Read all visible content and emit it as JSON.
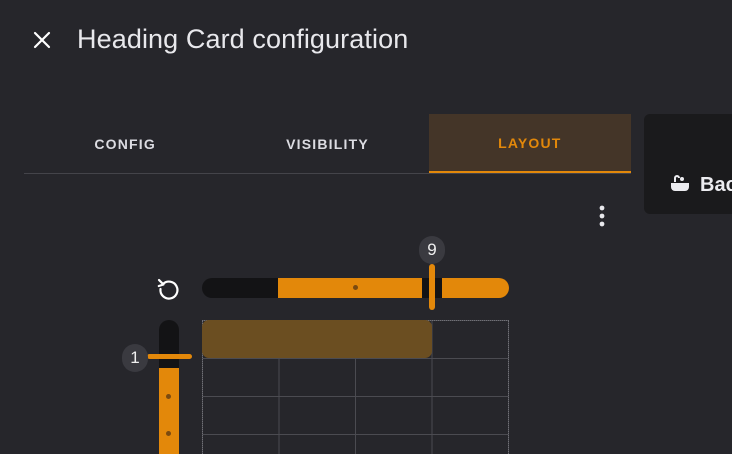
{
  "dialog": {
    "title": "Heading Card configuration",
    "close_icon": "close-icon"
  },
  "tabs": [
    {
      "label": "CONFIG",
      "active": false
    },
    {
      "label": "VISIBILITY",
      "active": false
    },
    {
      "label": "LAYOUT",
      "active": true
    }
  ],
  "preview": {
    "icon": "bathtub-icon",
    "text": "Bac"
  },
  "layout_editor": {
    "menu_icon": "dots-vertical-icon",
    "reset_icon": "restore-icon",
    "columns_value": "9",
    "rows_value": "1"
  },
  "colors": {
    "accent": "#e3880a",
    "background": "#26262b",
    "tab_active_bg": "#443528",
    "card_preview": "#6b4e21"
  }
}
